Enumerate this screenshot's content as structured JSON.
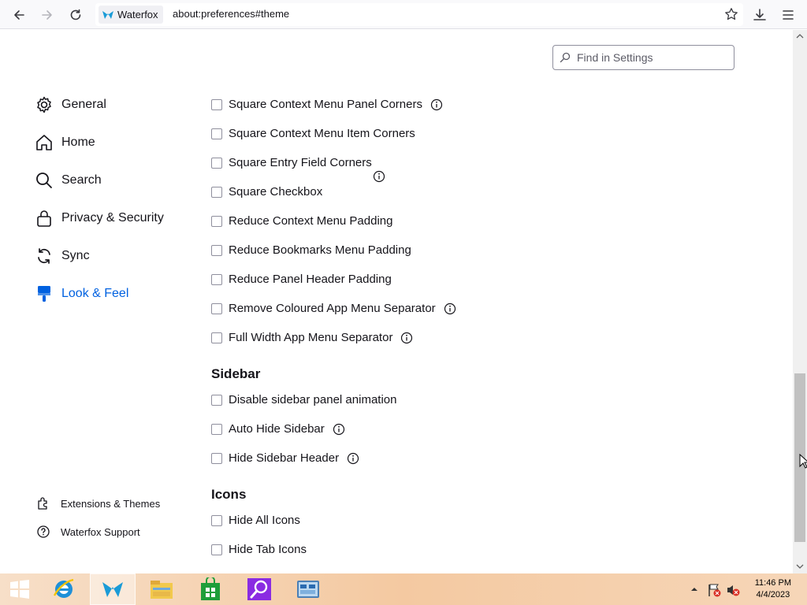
{
  "browser": {
    "identity_label": "Waterfox",
    "url": "about:preferences#theme"
  },
  "search": {
    "placeholder": "Find in Settings"
  },
  "nav": {
    "items": [
      {
        "label": "General",
        "icon": "gear-icon"
      },
      {
        "label": "Home",
        "icon": "home-icon"
      },
      {
        "label": "Search",
        "icon": "search-icon"
      },
      {
        "label": "Privacy & Security",
        "icon": "lock-icon"
      },
      {
        "label": "Sync",
        "icon": "sync-icon"
      },
      {
        "label": "Look & Feel",
        "icon": "paintbrush-icon",
        "active": true
      }
    ],
    "footer": [
      {
        "label": "Extensions & Themes",
        "icon": "puzzle-icon"
      },
      {
        "label": "Waterfox Support",
        "icon": "help-icon"
      }
    ]
  },
  "options": [
    {
      "label": "Square Context Menu Panel Corners",
      "checked": false,
      "info": true
    },
    {
      "label": "Square Context Menu Item Corners",
      "checked": false,
      "info": false
    },
    {
      "label": "Square Entry Field Corners",
      "checked": false,
      "info": false
    },
    {
      "label": "Square Checkbox",
      "checked": false,
      "info": false
    },
    {
      "label": "Reduce Context Menu Padding",
      "checked": false,
      "info": false
    },
    {
      "label": "Reduce Bookmarks Menu Padding",
      "checked": false,
      "info": false
    },
    {
      "label": "Reduce Panel Header Padding",
      "checked": false,
      "info": false
    },
    {
      "label": "Remove Coloured App Menu Separator",
      "checked": false,
      "info": true
    },
    {
      "label": "Full Width App Menu Separator",
      "checked": false,
      "info": true
    }
  ],
  "sidebar_section": {
    "title": "Sidebar",
    "options": [
      {
        "label": "Disable sidebar panel animation",
        "checked": false,
        "info": false
      },
      {
        "label": "Auto Hide Sidebar",
        "checked": false,
        "info": true
      },
      {
        "label": "Hide Sidebar Header",
        "checked": false,
        "info": true
      }
    ]
  },
  "icons_section": {
    "title": "Icons",
    "options": [
      {
        "label": "Hide All Icons",
        "checked": false,
        "info": false
      },
      {
        "label": "Hide Tab Icons",
        "checked": false,
        "info": false
      }
    ]
  },
  "taskbar": {
    "time": "11:46 PM",
    "date": "4/4/2023",
    "apps": [
      "internet-explorer-icon",
      "waterfox-icon",
      "file-explorer-icon",
      "store-icon",
      "search-app-icon",
      "control-panel-icon"
    ]
  },
  "colors": {
    "accent": "#0061e0",
    "text": "#15141a"
  }
}
